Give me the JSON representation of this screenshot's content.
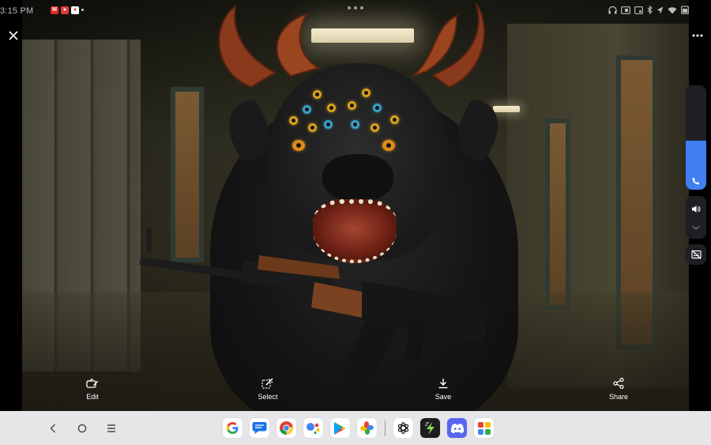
{
  "status_bar": {
    "time": "3:15 PM",
    "notifications": [
      "gmail-icon",
      "app-notification-icon",
      "app-notification-icon-2"
    ],
    "system_icons": [
      "headset-icon",
      "cast-icon",
      "screenshot-icon",
      "bluetooth-icon",
      "location-icon",
      "wifi-icon",
      "battery-icon"
    ]
  },
  "viewer": {
    "close_icon": "close-icon",
    "more_icon": "more-options-icon"
  },
  "side_panel": {
    "volume_level": 0.47,
    "volume_stream_icon": "phone-icon",
    "sound_icon": "speaker-icon",
    "expand_icon": "chevron-down-icon",
    "caption_icon": "live-caption-off-icon",
    "accent_color": "#3f7ff0"
  },
  "actions": [
    {
      "id": "edit",
      "label": "Edit",
      "icon": "edit-icon"
    },
    {
      "id": "select",
      "label": "Select",
      "icon": "select-magic-icon"
    },
    {
      "id": "save",
      "label": "Save",
      "icon": "download-icon"
    },
    {
      "id": "share",
      "label": "Share",
      "icon": "share-icon"
    }
  ],
  "taskbar": {
    "nav": [
      "back-icon",
      "home-icon",
      "recents-icon"
    ],
    "apps": [
      "google",
      "messages",
      "chrome",
      "assistant",
      "play-store",
      "photos",
      "chatgpt",
      "app-bolt",
      "discord",
      "app-grid"
    ]
  }
}
